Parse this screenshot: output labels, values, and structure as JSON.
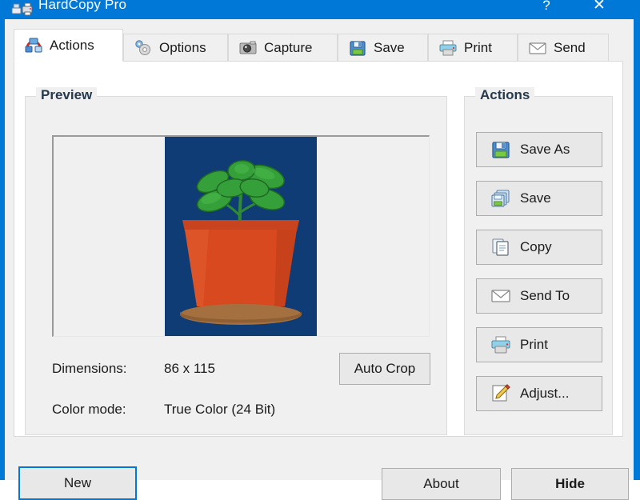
{
  "window": {
    "title": "HardCopy Pro",
    "icon": "app-printer-icon",
    "help_label": "?",
    "close_label": "✕",
    "accent_color": "#0078d7",
    "client_bg": "#f0f0f0"
  },
  "tabs": [
    {
      "label": "Actions",
      "icon": "actions-icon",
      "active": true
    },
    {
      "label": "Options",
      "icon": "gear-icon",
      "active": false
    },
    {
      "label": "Capture",
      "icon": "camera-icon",
      "active": false
    },
    {
      "label": "Save",
      "icon": "floppy-icon",
      "active": false
    },
    {
      "label": "Print",
      "icon": "printer-icon",
      "active": false
    },
    {
      "label": "Send",
      "icon": "envelope-icon",
      "active": false
    }
  ],
  "preview_group": {
    "title": "Preview",
    "image": {
      "alt": "potted-plant-screenshot",
      "background_color": "#103c75",
      "pot_color": "#d9471f",
      "saucer_color": "#a5703f",
      "leaf_color": "#3aa33a"
    },
    "auto_crop_label": "Auto Crop",
    "info": [
      {
        "label": "Dimensions:",
        "value": "86 x 115"
      },
      {
        "label": "Color mode:",
        "value": "True Color (24 Bit)"
      }
    ]
  },
  "actions_group": {
    "title": "Actions",
    "buttons": [
      {
        "label": "Save As",
        "icon": "floppy-icon"
      },
      {
        "label": "Save",
        "icon": "floppy-stack-icon"
      },
      {
        "label": "Copy",
        "icon": "copy-icon"
      },
      {
        "label": "Send To",
        "icon": "envelope-icon"
      },
      {
        "label": "Print",
        "icon": "printer-icon"
      },
      {
        "label": "Adjust...",
        "icon": "pencil-icon"
      }
    ]
  },
  "footer": {
    "new_label": "New",
    "about_label": "About",
    "hide_label": "Hide"
  }
}
